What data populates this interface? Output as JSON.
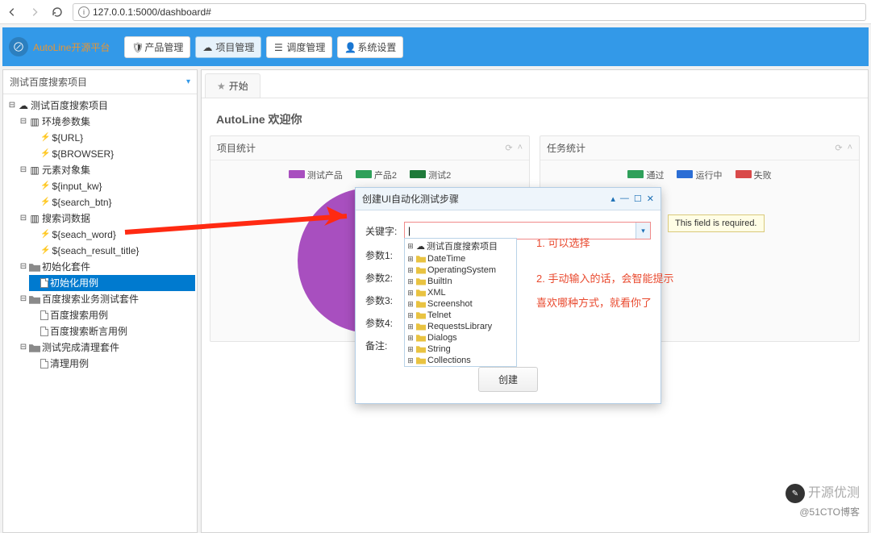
{
  "browser": {
    "url": "127.0.0.1:5000/dashboard#"
  },
  "header": {
    "app_name": "AutoLine开源平台",
    "menu": [
      {
        "label": "产品管理",
        "icon": "shield-icon"
      },
      {
        "label": "项目管理",
        "icon": "cloud-icon"
      },
      {
        "label": "调度管理",
        "icon": "list-icon"
      },
      {
        "label": "系统设置",
        "icon": "user-icon"
      }
    ]
  },
  "sidebar": {
    "title": "测试百度搜索项目",
    "tree": {
      "project": "测试百度搜索项目",
      "env_group": "环境参数集",
      "env_items": [
        "${URL}",
        "${BROWSER}"
      ],
      "elem_group": "元素对象集",
      "elem_items": [
        "${input_kw}",
        "${search_btn}"
      ],
      "search_group": "搜索词数据",
      "search_items": [
        "${seach_word}",
        "${seach_result_title}"
      ],
      "init_suite": "初始化套件",
      "init_case": "初始化用例",
      "biz_suite": "百度搜索业务测试套件",
      "biz_items": [
        "百度搜索用例",
        "百度搜索断言用例"
      ],
      "clean_suite": "测试完成清理套件",
      "clean_item": "清理用例"
    }
  },
  "main": {
    "tab": "开始",
    "welcome": "AutoLine 欢迎你",
    "panel1": {
      "title": "项目统计",
      "legend": [
        "测试产品",
        "产品2",
        "测试2"
      ]
    },
    "panel2": {
      "title": "任务统计",
      "legend": [
        "通过",
        "运行中",
        "失败"
      ]
    }
  },
  "dialog": {
    "title": "创建UI自动化测试步骤",
    "fields": [
      "关键字:",
      "参数1:",
      "参数2:",
      "参数3:",
      "参数4:",
      "备注:"
    ],
    "dropdown": [
      "测试百度搜索项目",
      "DateTime",
      "OperatingSystem",
      "BuiltIn",
      "XML",
      "Screenshot",
      "Telnet",
      "RequestsLibrary",
      "Dialogs",
      "String",
      "Collections"
    ],
    "create": "创建"
  },
  "tooltip": "This field is required.",
  "annotations": {
    "line1": "1. 可以选择",
    "line2": "2. 手动输入的话，会智能提示",
    "line3": "喜欢哪种方式，就看你了"
  },
  "watermark": {
    "line1": "开源优测",
    "line2": "@51CTO博客"
  },
  "chart_data": [
    {
      "type": "pie",
      "title": "项目统计",
      "categories": [
        "测试产品",
        "产品2",
        "测试2"
      ],
      "values": [
        85,
        10,
        5
      ],
      "colors": [
        "#a84fbf",
        "#2fa05a",
        "#1f7a3a"
      ]
    },
    {
      "type": "pie",
      "title": "任务统计",
      "categories": [
        "通过",
        "运行中",
        "失败"
      ],
      "values": [
        0,
        0,
        0
      ],
      "colors": [
        "#2fa05a",
        "#2c6ed5",
        "#d94a4a"
      ]
    }
  ]
}
